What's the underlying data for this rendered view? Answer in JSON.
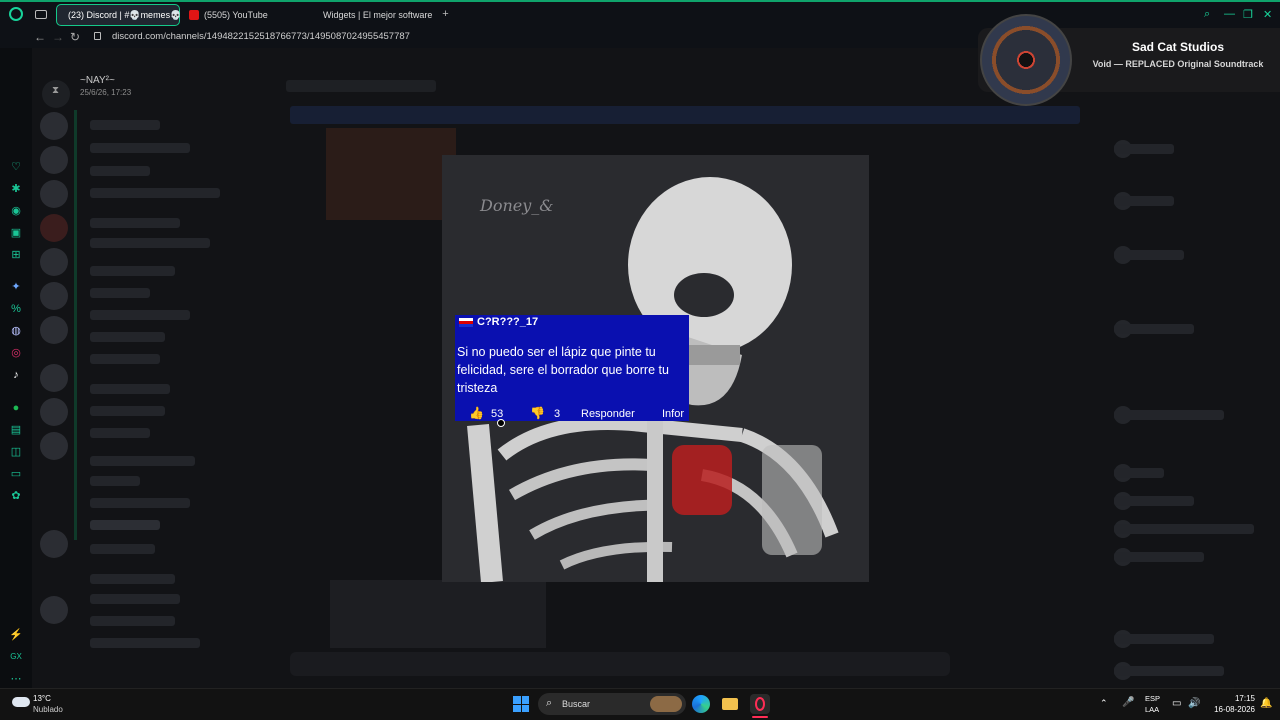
{
  "browser": {
    "tabs": [
      {
        "label": "(23) Discord | #💀memes💀",
        "active": true
      },
      {
        "label": "(5505) YouTube",
        "active": false
      },
      {
        "label": "Widgets | El mejor software",
        "active": false
      }
    ],
    "url": "discord.com/channels/1494822152518766773/1495087024955457787"
  },
  "discord": {
    "server_name": "~NAY²~",
    "server_date": "25/6/26, 17:23"
  },
  "now_playing": {
    "artist": "Sad Cat Studios",
    "track": "Void — REPLACED Original Soundtrack"
  },
  "image": {
    "watermark": "Doney_&",
    "comment": {
      "user": "C?R???_17",
      "text": "Si no puedo ser el lápiz que pinte tu felicidad, sere el borrador que borre tu tristeza",
      "likes": "53",
      "dislikes": "3",
      "reply_label": "Responder",
      "report_label": "Infor"
    }
  },
  "taskbar": {
    "weather_temp": "13°C",
    "weather_desc": "Nublado",
    "search_label": "Buscar",
    "lang": "ESP",
    "lang_sub": "LAA",
    "time": "17:15",
    "date": "16-08-2026"
  },
  "colors": {
    "accent": "#15c98a",
    "comment_bg": "#0a10b0"
  }
}
